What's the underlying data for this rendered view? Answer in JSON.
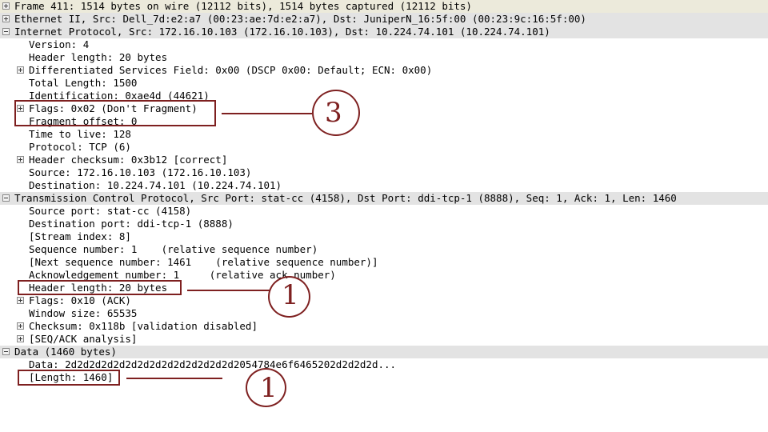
{
  "window": {
    "title": "Wireshark Packet Details",
    "pane_name": "packet-detail-tree"
  },
  "tree": {
    "rows": [
      {
        "indent": 0,
        "expander": "plus",
        "bg": "cream",
        "text": "Frame 411: 1514 bytes on wire (12112 bits), 1514 bytes captured (12112 bits)"
      },
      {
        "indent": 0,
        "expander": "plus",
        "bg": "gray",
        "text": "Ethernet II, Src: Dell_7d:e2:a7 (00:23:ae:7d:e2:a7), Dst: JuniperN_16:5f:00 (00:23:9c:16:5f:00)"
      },
      {
        "indent": 0,
        "expander": "minus",
        "bg": "gray",
        "text": "Internet Protocol, Src: 172.16.10.103 (172.16.10.103), Dst: 10.224.74.101 (10.224.74.101)"
      },
      {
        "indent": 1,
        "expander": "none",
        "bg": "white",
        "text": "Version: 4"
      },
      {
        "indent": 1,
        "expander": "none",
        "bg": "white",
        "text": "Header length: 20 bytes"
      },
      {
        "indent": 1,
        "expander": "plus",
        "bg": "white",
        "text": "Differentiated Services Field: 0x00 (DSCP 0x00: Default; ECN: 0x00)"
      },
      {
        "indent": 1,
        "expander": "none",
        "bg": "white",
        "text": "Total Length: 1500"
      },
      {
        "indent": 1,
        "expander": "none",
        "bg": "white",
        "text": "Identification: 0xae4d (44621)"
      },
      {
        "indent": 1,
        "expander": "plus",
        "bg": "white",
        "text": "Flags: 0x02 (Don't Fragment)"
      },
      {
        "indent": 1,
        "expander": "none",
        "bg": "white",
        "text": "Fragment offset: 0"
      },
      {
        "indent": 1,
        "expander": "none",
        "bg": "white",
        "text": "Time to live: 128"
      },
      {
        "indent": 1,
        "expander": "none",
        "bg": "white",
        "text": "Protocol: TCP (6)"
      },
      {
        "indent": 1,
        "expander": "plus",
        "bg": "white",
        "text": "Header checksum: 0x3b12 [correct]"
      },
      {
        "indent": 1,
        "expander": "none",
        "bg": "white",
        "text": "Source: 172.16.10.103 (172.16.10.103)"
      },
      {
        "indent": 1,
        "expander": "none",
        "bg": "white",
        "text": "Destination: 10.224.74.101 (10.224.74.101)"
      },
      {
        "indent": 0,
        "expander": "minus",
        "bg": "gray",
        "text": "Transmission Control Protocol, Src Port: stat-cc (4158), Dst Port: ddi-tcp-1 (8888), Seq: 1, Ack: 1, Len: 1460"
      },
      {
        "indent": 1,
        "expander": "none",
        "bg": "white",
        "text": "Source port: stat-cc (4158)"
      },
      {
        "indent": 1,
        "expander": "none",
        "bg": "white",
        "text": "Destination port: ddi-tcp-1 (8888)"
      },
      {
        "indent": 1,
        "expander": "none",
        "bg": "white",
        "text": "[Stream index: 8]"
      },
      {
        "indent": 1,
        "expander": "none",
        "bg": "white",
        "text": "Sequence number: 1    (relative sequence number)"
      },
      {
        "indent": 1,
        "expander": "none",
        "bg": "white",
        "text": "[Next sequence number: 1461    (relative sequence number)]"
      },
      {
        "indent": 1,
        "expander": "none",
        "bg": "white",
        "text": "Acknowledgement number: 1     (relative ack number)"
      },
      {
        "indent": 1,
        "expander": "none",
        "bg": "white",
        "text": "Header length: 20 bytes"
      },
      {
        "indent": 1,
        "expander": "plus",
        "bg": "white",
        "text": "Flags: 0x10 (ACK)"
      },
      {
        "indent": 1,
        "expander": "none",
        "bg": "white",
        "text": "Window size: 65535"
      },
      {
        "indent": 1,
        "expander": "plus",
        "bg": "white",
        "text": "Checksum: 0x118b [validation disabled]"
      },
      {
        "indent": 1,
        "expander": "plus",
        "bg": "white",
        "text": "[SEQ/ACK analysis]"
      },
      {
        "indent": 0,
        "expander": "minus",
        "bg": "gray",
        "text": "Data (1460 bytes)"
      },
      {
        "indent": 1,
        "expander": "none",
        "bg": "white",
        "text": "Data: 2d2d2d2d2d2d2d2d2d2d2d2d2d2d2054784e6f6465202d2d2d2d..."
      },
      {
        "indent": 1,
        "expander": "none",
        "bg": "white",
        "text": "[Length: 1460]"
      }
    ]
  },
  "annotations": {
    "color": "#7e2020",
    "items": [
      {
        "id": "ann-ip-flags",
        "label": "3",
        "target": "Flags: 0x02 (Don't Fragment) / Fragment offset: 0"
      },
      {
        "id": "ann-tcp-hdrlen",
        "label": "1",
        "target": "Header length: 20 bytes"
      },
      {
        "id": "ann-data-len",
        "label": "1",
        "target": "[Length: 1460]"
      }
    ]
  }
}
